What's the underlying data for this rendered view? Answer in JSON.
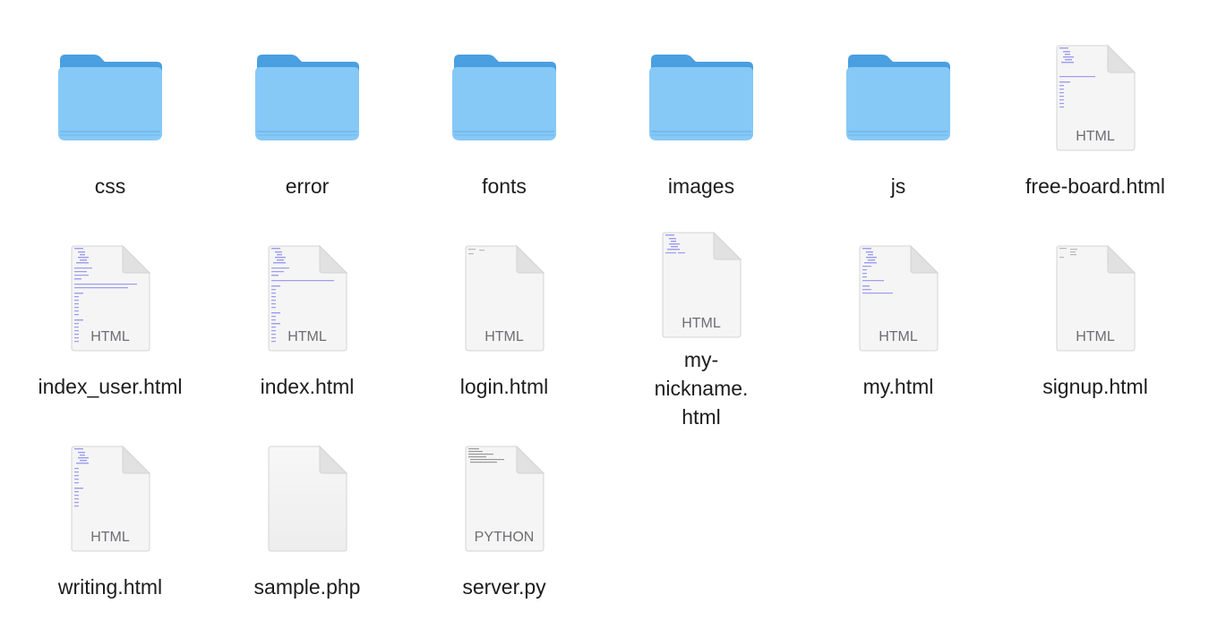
{
  "items": [
    {
      "name": "css",
      "kind": "folder",
      "icon": "folder-icon"
    },
    {
      "name": "error",
      "kind": "folder",
      "icon": "folder-icon"
    },
    {
      "name": "fonts",
      "kind": "folder",
      "icon": "folder-icon"
    },
    {
      "name": "images",
      "kind": "folder",
      "icon": "folder-icon"
    },
    {
      "name": "js",
      "kind": "folder",
      "icon": "folder-icon"
    },
    {
      "name": "free-board.html",
      "kind": "file",
      "type_label": "HTML",
      "icon": "html-file-icon"
    },
    {
      "name": "index_user.html",
      "kind": "file",
      "type_label": "HTML",
      "icon": "html-file-icon"
    },
    {
      "name": "index.html",
      "kind": "file",
      "type_label": "HTML",
      "icon": "html-file-icon"
    },
    {
      "name": "login.html",
      "kind": "file",
      "type_label": "HTML",
      "icon": "html-file-icon"
    },
    {
      "name": "my-nickname.html",
      "kind": "file",
      "type_label": "HTML",
      "icon": "html-file-icon"
    },
    {
      "name": "my.html",
      "kind": "file",
      "type_label": "HTML",
      "icon": "html-file-icon"
    },
    {
      "name": "signup.html",
      "kind": "file",
      "type_label": "HTML",
      "icon": "html-file-icon"
    },
    {
      "name": "writing.html",
      "kind": "file",
      "type_label": "HTML",
      "icon": "html-file-icon"
    },
    {
      "name": "sample.php",
      "kind": "file",
      "type_label": "",
      "icon": "php-file-icon"
    },
    {
      "name": "server.py",
      "kind": "file",
      "type_label": "PYTHON",
      "icon": "python-file-icon"
    }
  ],
  "colors": {
    "folder_back": "#4a9fe0",
    "folder_front": "#86c9f6",
    "folder_line": "#6eb6ec",
    "doc_fill": "#f5f5f5",
    "doc_edge": "#d4d4d4",
    "type_text": "#6e6e73",
    "preview_text": "#7b7bd6"
  }
}
